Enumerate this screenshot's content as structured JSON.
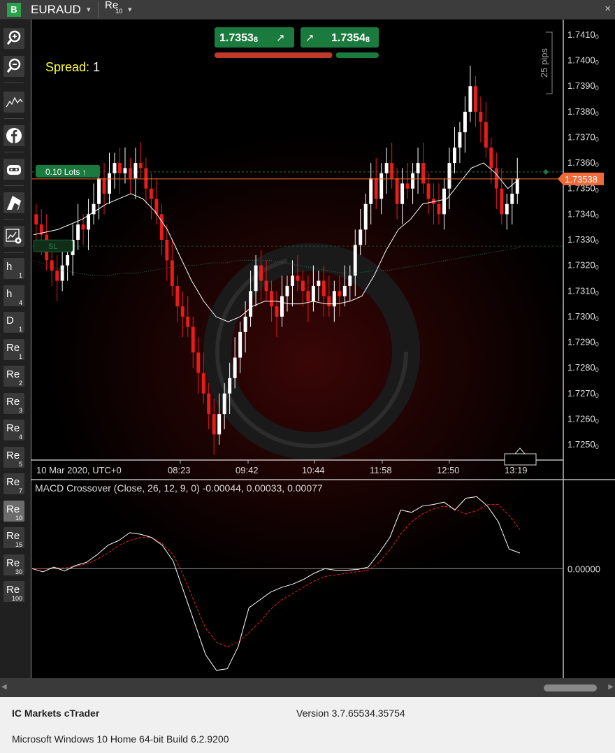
{
  "window": {
    "brand": "B",
    "symbol": "EURAUD",
    "timeframe": "Re",
    "timeframe_sub": "10",
    "dropdown_glyph": "▾",
    "close_glyph": "×"
  },
  "sidebar": {
    "tools": [
      "zoom-in",
      "zoom-out",
      "chart-type",
      "facebook",
      "cbot",
      "draw",
      "settings"
    ],
    "timeframes": [
      {
        "t": "h",
        "s": "1"
      },
      {
        "t": "h",
        "s": "4"
      },
      {
        "t": "D",
        "s": "1"
      },
      {
        "t": "Re",
        "s": "1"
      },
      {
        "t": "Re",
        "s": "2"
      },
      {
        "t": "Re",
        "s": "3"
      },
      {
        "t": "Re",
        "s": "4"
      },
      {
        "t": "Re",
        "s": "5"
      },
      {
        "t": "Re",
        "s": "7"
      },
      {
        "t": "Re",
        "s": "10",
        "active": true
      },
      {
        "t": "Re",
        "s": "15"
      },
      {
        "t": "Re",
        "s": "30"
      },
      {
        "t": "Re",
        "s": "100"
      }
    ]
  },
  "trade_panel": {
    "sell_price": "1.7353",
    "sell_pip": "8",
    "buy_price": "1.7354",
    "buy_pip": "8",
    "sell_ratio": 0.73,
    "colors": {
      "sell": "#c0392b",
      "buy": "#1b7a3d"
    }
  },
  "spread": {
    "label": "Spread:",
    "value": "1"
  },
  "scale": {
    "pips_label": "25 pips"
  },
  "position": {
    "lots_label": "0.10 Lots",
    "sl_label": "SL"
  },
  "price_axis": {
    "labels": [
      "1.7410",
      "1.7400",
      "1.7390",
      "1.7380",
      "1.7370",
      "1.7360",
      "1.7350",
      "1.7340",
      "1.7330",
      "1.7320",
      "1.7310",
      "1.7300",
      "1.7290",
      "1.7280",
      "1.7270",
      "1.7260",
      "1.7250"
    ],
    "label_suffix": "0",
    "current": "1.73538"
  },
  "time_axis": {
    "labels": [
      "10 Mar 2020, UTC+0",
      "08:23",
      "09:42",
      "10:44",
      "11:58",
      "12:50",
      "13:19"
    ]
  },
  "macd": {
    "title": "MACD Crossover (Close, 26, 12, 9, 0) -0.00044, 0.00033, 0.00077",
    "zero_label": "0.00000"
  },
  "chart_data": [
    {
      "type": "candlestick",
      "title": "EURAUD Re10",
      "ylim": [
        1.7244,
        1.7416
      ],
      "open": [
        1.734,
        1.7336,
        1.7332,
        1.7322,
        1.7318,
        1.7314,
        1.732,
        1.7324,
        1.733,
        1.7336,
        1.7334,
        1.734,
        1.7344,
        1.7354,
        1.7348,
        1.7356,
        1.736,
        1.7356,
        1.7358,
        1.7354,
        1.736,
        1.7358,
        1.735,
        1.7346,
        1.734,
        1.733,
        1.7322,
        1.7312,
        1.7304,
        1.73,
        1.7296,
        1.7286,
        1.7278,
        1.727,
        1.7262,
        1.7254,
        1.7262,
        1.727,
        1.7276,
        1.7284,
        1.7294,
        1.73,
        1.731,
        1.732,
        1.7314,
        1.731,
        1.7304,
        1.73,
        1.7308,
        1.7312,
        1.7316,
        1.7314,
        1.731,
        1.7306,
        1.7312,
        1.7314,
        1.7308,
        1.7304,
        1.731,
        1.7308,
        1.7312,
        1.7316,
        1.7328,
        1.7334,
        1.7344,
        1.7354,
        1.7346,
        1.7356,
        1.736,
        1.7354,
        1.7344,
        1.7352,
        1.735,
        1.7356,
        1.736,
        1.7352,
        1.7346,
        1.7344,
        1.734,
        1.735,
        1.736,
        1.7366,
        1.7372,
        1.738,
        1.739,
        1.738,
        1.7376,
        1.7366,
        1.7358,
        1.735,
        1.734,
        1.7344,
        1.7348
      ],
      "close": [
        1.7336,
        1.7332,
        1.7322,
        1.7318,
        1.7314,
        1.732,
        1.7324,
        1.733,
        1.7336,
        1.7334,
        1.734,
        1.7344,
        1.7354,
        1.7348,
        1.7356,
        1.736,
        1.7356,
        1.7358,
        1.7354,
        1.736,
        1.7358,
        1.735,
        1.7346,
        1.734,
        1.733,
        1.7322,
        1.7312,
        1.7304,
        1.73,
        1.7296,
        1.7286,
        1.7278,
        1.727,
        1.7262,
        1.7254,
        1.7262,
        1.727,
        1.7276,
        1.7284,
        1.7294,
        1.73,
        1.731,
        1.732,
        1.7314,
        1.731,
        1.7304,
        1.73,
        1.7308,
        1.7312,
        1.7316,
        1.7314,
        1.731,
        1.7306,
        1.7312,
        1.7314,
        1.7308,
        1.7304,
        1.731,
        1.7308,
        1.7312,
        1.7316,
        1.7328,
        1.7334,
        1.7344,
        1.7354,
        1.7346,
        1.7356,
        1.736,
        1.7354,
        1.7344,
        1.7352,
        1.735,
        1.7356,
        1.736,
        1.7352,
        1.7346,
        1.7344,
        1.734,
        1.735,
        1.736,
        1.7366,
        1.7372,
        1.738,
        1.739,
        1.738,
        1.7376,
        1.7366,
        1.7358,
        1.735,
        1.734,
        1.7344,
        1.7348,
        1.7354
      ],
      "current": 1.73538,
      "position_line": 1.73565,
      "sl_line": 1.73275,
      "sma_slow": [
        1.7322,
        1.732,
        1.7318,
        1.7317,
        1.7316,
        1.7316,
        1.7317,
        1.7317,
        1.7318,
        1.7319,
        1.732,
        1.732,
        1.7321,
        1.7321,
        1.7322,
        1.7322,
        1.7322,
        1.7321,
        1.732,
        1.7319,
        1.7318,
        1.7317,
        1.7317,
        1.7318,
        1.7318,
        1.7319,
        1.732,
        1.7321,
        1.7322,
        1.7323,
        1.7324,
        1.7325,
        1.7326,
        1.7327
      ],
      "sma_fast": [
        1.7332,
        1.7333,
        1.7334,
        1.7336,
        1.7338,
        1.7341,
        1.7344,
        1.7346,
        1.7348,
        1.7346,
        1.7341,
        1.7334,
        1.7324,
        1.7314,
        1.7306,
        1.73,
        1.7298,
        1.73,
        1.7304,
        1.7306,
        1.7306,
        1.7305,
        1.7305,
        1.7306,
        1.7305,
        1.7305,
        1.7306,
        1.7308,
        1.7316,
        1.7326,
        1.7334,
        1.7338,
        1.7344,
        1.7345,
        1.7346,
        1.7352,
        1.7358,
        1.736,
        1.7356,
        1.735,
        1.7354
      ]
    },
    {
      "type": "line",
      "title": "MACD Crossover (Close, 26, 12, 9, 0)",
      "ylim": [
        -0.0014,
        0.00112
      ],
      "series": [
        {
          "name": "MACD",
          "values": [
            0.0,
            -4e-05,
            2e-05,
            -3e-05,
            4e-05,
            8e-05,
            0.00018,
            0.0003,
            0.00036,
            0.00046,
            0.00044,
            0.0004,
            0.0003,
            0.0001,
            -0.0003,
            -0.0007,
            -0.0011,
            -0.0013,
            -0.00128,
            -0.001,
            -0.0005,
            -0.0004,
            -0.0003,
            -0.00024,
            -0.0002,
            -0.00014,
            -6e-05,
            0.0,
            -2e-05,
            -2e-05,
            -1e-05,
            2e-05,
            0.0002,
            0.0004,
            0.00075,
            0.00072,
            0.0008,
            0.00082,
            0.00085,
            0.00075,
            0.0009,
            0.00092,
            0.0008,
            0.0006,
            0.00025,
            0.0002
          ]
        },
        {
          "name": "Signal",
          "values": [
            0.0,
            0.0,
            1e-05,
            1e-05,
            3e-05,
            6e-05,
            0.00012,
            0.0002,
            0.0003,
            0.00036,
            0.0004,
            0.0004,
            0.00032,
            0.00018,
            -0.0001,
            -0.00044,
            -0.00076,
            -0.00094,
            -0.001,
            -0.00094,
            -0.00082,
            -0.00068,
            -0.00052,
            -0.0004,
            -0.00032,
            -0.00024,
            -0.00016,
            -0.0001,
            -8e-05,
            -6e-05,
            -4e-05,
            -2e-05,
            8e-05,
            0.00024,
            0.00044,
            0.0006,
            0.0007,
            0.00076,
            0.0008,
            0.00076,
            0.0007,
            0.00074,
            0.00082,
            0.00082,
            0.00068,
            0.0005
          ]
        }
      ],
      "zero_line": 0,
      "colors": {
        "macd": "#ffffff",
        "signal": "#e02020"
      }
    }
  ]
}
